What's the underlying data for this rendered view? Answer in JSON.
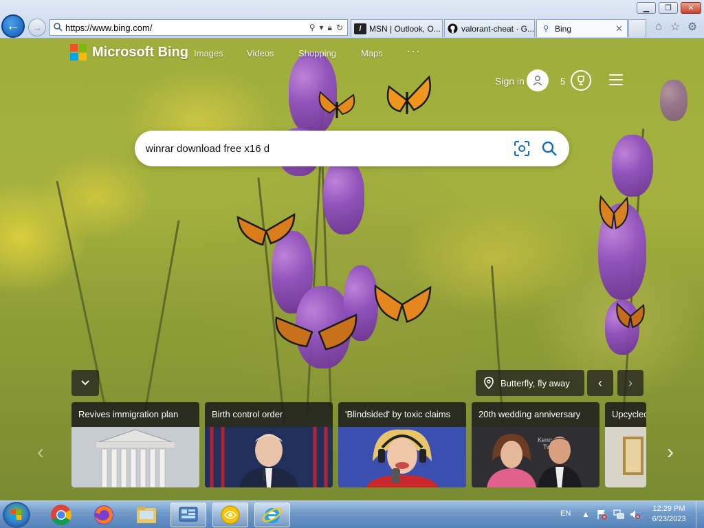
{
  "window": {
    "controls": {
      "minimize": "▁",
      "maximize": "❐",
      "close": "✕"
    }
  },
  "address_bar": {
    "url": "https://www.bing.com/",
    "tools": [
      "search-icon",
      "dropdown-icon",
      "lock-icon",
      "refresh-icon"
    ]
  },
  "tabs": [
    {
      "label": "MSN | Outlook, O...",
      "icon": "msn-icon",
      "active": false
    },
    {
      "label": "valorant-cheat · G...",
      "icon": "github-icon",
      "active": false
    },
    {
      "label": "Bing",
      "icon": "search-icon",
      "active": true
    }
  ],
  "bing": {
    "brand": "Microsoft Bing",
    "nav": [
      "Images",
      "Videos",
      "Shopping",
      "Maps"
    ],
    "more": "···",
    "sign_in": "Sign in",
    "rewards_count": "5",
    "search": {
      "value": "winrar download free x16 d",
      "placeholder": ""
    },
    "image_caption": "Butterfly, fly away",
    "cards": [
      {
        "title": "Revives immigration plan"
      },
      {
        "title": "Birth control order"
      },
      {
        "title": "'Blindsided' by toxic claims"
      },
      {
        "title": "20th wedding anniversary"
      },
      {
        "title": "Upcycled"
      }
    ],
    "card4_sign": "Kennedy\nTwain"
  },
  "taskbar": {
    "apps": [
      "Chrome",
      "Firefox",
      "Windows Explorer",
      "Control Panel",
      "App",
      "Internet Explorer"
    ],
    "language": "EN",
    "time": "12:29 PM",
    "date": "6/23/2023"
  },
  "colors": {
    "ie_blue": "#1257b5",
    "ms_red": "#f25022",
    "ms_green": "#7fba00",
    "ms_blue": "#00a4ef",
    "ms_yellow": "#ffb900",
    "bing_accent": "#0f6cbd"
  }
}
